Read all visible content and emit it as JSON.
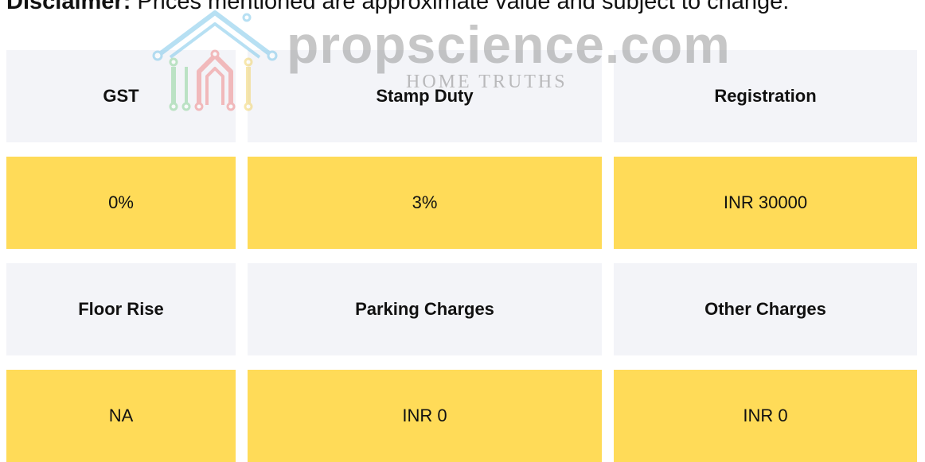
{
  "disclaimer": {
    "label": "Disclaimer:",
    "text": " Prices mentioned are approximate value and subject to change."
  },
  "watermark": {
    "brand": "propscience.com",
    "tagline": "HOME TRUTHS"
  },
  "charges": {
    "headers_row1": [
      "GST",
      "Stamp Duty",
      "Registration"
    ],
    "values_row1": [
      "0%",
      "3%",
      "INR 30000"
    ],
    "headers_row2": [
      "Floor Rise",
      "Parking Charges",
      "Other Charges"
    ],
    "values_row2": [
      "NA",
      "INR 0",
      "INR 0"
    ]
  },
  "colors": {
    "header_bg": "#f3f4f8",
    "value_bg": "#ffdb58",
    "logo_blue": "#7ec8ea",
    "logo_red": "#f08a8a",
    "logo_green": "#8fd49a",
    "logo_yellow": "#f2d46b"
  }
}
